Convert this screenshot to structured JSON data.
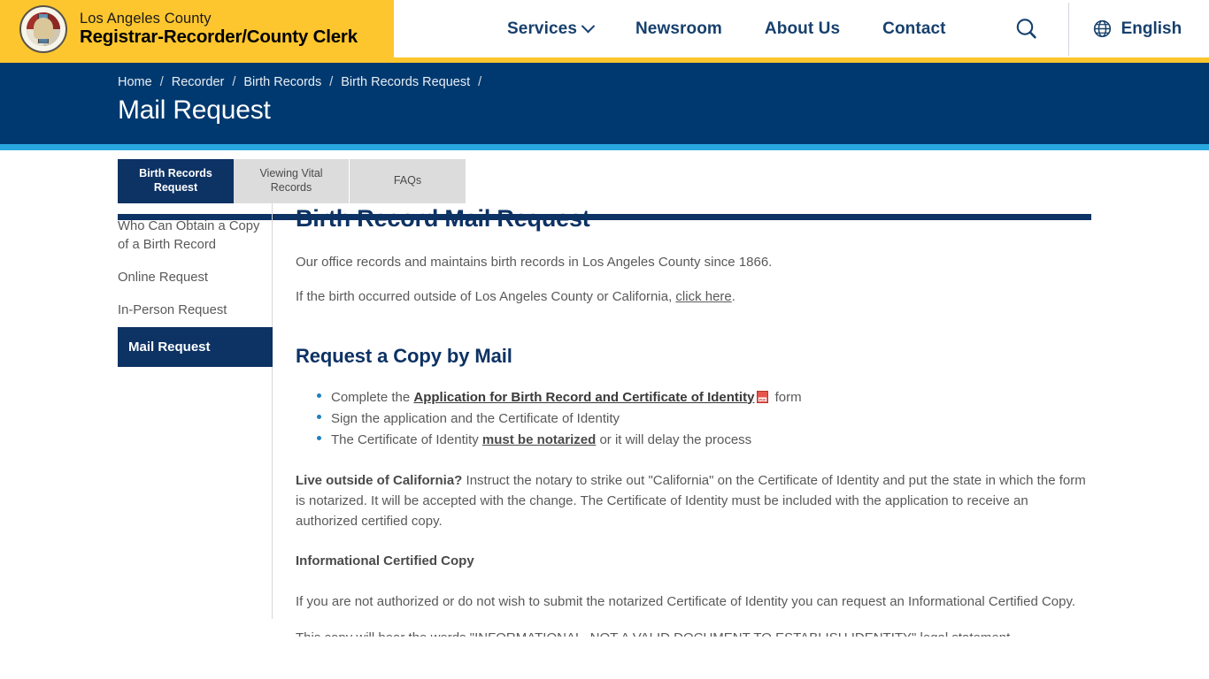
{
  "header": {
    "agency_line1": "Los Angeles County",
    "agency_line2": "Registrar-Recorder/County Clerk",
    "seal_alt": "la-county-seal",
    "nav": [
      {
        "label": "Services",
        "has_dropdown": true
      },
      {
        "label": "Newsroom",
        "has_dropdown": false
      },
      {
        "label": "About Us",
        "has_dropdown": false
      },
      {
        "label": "Contact",
        "has_dropdown": false
      }
    ],
    "search_icon": "search-icon",
    "language_icon": "globe-icon",
    "language_label": "English",
    "brand_yellow": "#fdc62e",
    "brand_navy": "#17406d"
  },
  "band": {
    "breadcrumbs": [
      "Home",
      "Recorder",
      "Birth Records",
      "Birth Records Request"
    ],
    "separator": "/",
    "trailing_separator": "/",
    "title": "Mail Request",
    "band_color": "#00396f",
    "accent_color": "#29a8df"
  },
  "tabs": [
    {
      "label": "Birth Records Request",
      "active": true
    },
    {
      "label": "Viewing Vital Records",
      "active": false
    },
    {
      "label": "FAQs",
      "active": false
    }
  ],
  "sidebar": {
    "items": [
      {
        "label": "Who Can Obtain a Copy of a Birth Record",
        "active": false
      },
      {
        "label": "Online Request",
        "active": false
      },
      {
        "label": "In-Person Request",
        "active": false
      },
      {
        "label": "Mail Request",
        "active": true
      }
    ]
  },
  "main": {
    "title": "Birth Record Mail Request",
    "intro_1": "Our office records and maintains birth records in Los Angeles County since 1866.",
    "intro_2_before": "If the birth occurred outside of Los Angeles County or California, ",
    "intro_2_link": "click here",
    "intro_2_after": ".",
    "section_title": "Request a Copy by Mail",
    "bullets": [
      {
        "before": "Complete the ",
        "link": "Application for Birth Record and Certificate of Identity",
        "icon": "pdf-icon",
        "after": " form"
      },
      {
        "before": "Sign the application and the Certificate of Identity",
        "link": "",
        "after": ""
      },
      {
        "before": "The Certificate of Identity ",
        "link": "must be notarized",
        "after": " or it will delay the process"
      }
    ],
    "outside_label": "Live outside of California?",
    "outside_text": " Instruct the notary to strike out \"California\" on the Certificate of Identity and put the state in which the form is notarized. It will be accepted with the change. The Certificate of Identity must be included with the application to receive an authorized certified copy.",
    "info_heading": "Informational Certified Copy",
    "info_text": "If you are not authorized or do not wish to submit the notarized Certificate of Identity you can request an Informational Certified Copy.",
    "clipped_text": "This copy will bear the words \"INFORMATIONAL, NOT A VALID DOCUMENT TO ESTABLISH IDENTITY\" legal statement"
  }
}
